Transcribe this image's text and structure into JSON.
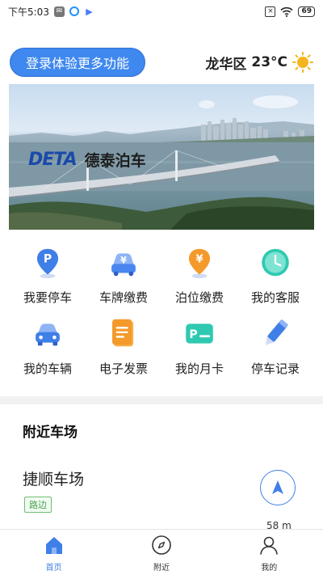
{
  "status_bar": {
    "time": "下午5:03",
    "battery": "69"
  },
  "header": {
    "login_label": "登录体验更多功能",
    "location": "龙华区",
    "temperature": "23°C",
    "weather_icon": "sun-icon"
  },
  "banner": {
    "logo_mark": "DETA",
    "logo_text": "德泰泊车"
  },
  "menu": {
    "items": [
      {
        "label": "我要停车",
        "icon": "parking-pin-icon",
        "color": "#3f7fe8"
      },
      {
        "label": "车牌缴费",
        "icon": "car-plate-pay-icon",
        "color": "#4a86f0"
      },
      {
        "label": "泊位缴费",
        "icon": "yen-pin-icon",
        "color": "#f39a2b"
      },
      {
        "label": "我的客服",
        "icon": "clock-icon",
        "color": "#2fc9b1"
      },
      {
        "label": "我的车辆",
        "icon": "car-icon",
        "color": "#3f7fe8"
      },
      {
        "label": "电子发票",
        "icon": "invoice-icon",
        "color": "#f39a2b"
      },
      {
        "label": "我的月卡",
        "icon": "parking-card-icon",
        "color": "#2fc9b1"
      },
      {
        "label": "停车记录",
        "icon": "pencil-icon",
        "color": "#3f7fe8"
      }
    ]
  },
  "nearby": {
    "title": "附近车场",
    "lot_name": "捷顺车场",
    "lot_tag": "路边",
    "distance": "58 m"
  },
  "tabbar": {
    "tabs": [
      {
        "label": "首页",
        "icon": "home-icon",
        "active": true
      },
      {
        "label": "附近",
        "icon": "compass-icon",
        "active": false
      },
      {
        "label": "我的",
        "icon": "user-icon",
        "active": false
      }
    ]
  }
}
